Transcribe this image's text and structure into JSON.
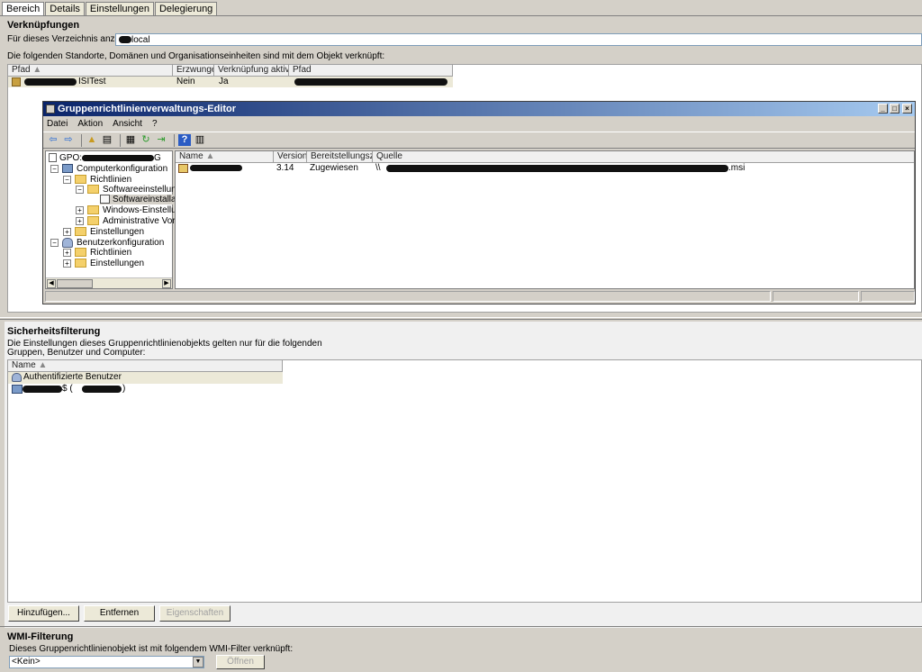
{
  "tabs": [
    "Bereich",
    "Details",
    "Einstellungen",
    "Delegierung"
  ],
  "links": {
    "title": "Verknüpfungen",
    "dir_label": "Für dieses Verzeichnis anzeigen:",
    "dir_value": "local",
    "description": "Die folgenden Standorte, Domänen und Organisationseinheiten sind mit dem Objekt verknüpft:",
    "columns": [
      "Pfad",
      "Erzwungen",
      "Verknüpfung aktiviert",
      "Pfad"
    ],
    "row": {
      "path_suffix": "SITest",
      "enforced": "Nein",
      "enabled": "Ja"
    }
  },
  "editor": {
    "title": "Gruppenrichtlinienverwaltungs-Editor",
    "menu": [
      "Datei",
      "Aktion",
      "Ansicht",
      "?"
    ],
    "tree": {
      "root": "GPO:",
      "computer": "Computerkonfiguration",
      "policies": "Richtlinien",
      "software_settings": "Softwareeinstellungen",
      "software_install": "Softwareinstallatio",
      "windows_settings": "Windows-Einstellungen",
      "admin_templates": "Administrative Vorlagen",
      "settings": "Einstellungen",
      "user": "Benutzerkonfiguration",
      "user_policies": "Richtlinien",
      "user_settings": "Einstellungen"
    },
    "columns": [
      "Name",
      "Version",
      "Bereitstellungsz...",
      "Quelle"
    ],
    "row": {
      "version": "3.14",
      "deployment": "Zugewiesen",
      "source_prefix": "\\\\",
      "source_suffix": ".msi"
    }
  },
  "security": {
    "title": "Sicherheitsfilterung",
    "description_line1": "Die Einstellungen dieses Gruppenrichtlinienobjekts gelten nur für die folgenden",
    "description_line2": "Gruppen, Benutzer und Computer:",
    "column": "Name",
    "items": [
      "Authentifizierte Benutzer",
      "$ (",
      ")"
    ],
    "buttons": {
      "add": "Hinzufügen...",
      "remove": "Entfernen",
      "properties": "Eigenschaften"
    }
  },
  "wmi": {
    "title": "WMI-Filterung",
    "description": "Dieses Gruppenrichtlinienobjekt ist mit folgendem WMI-Filter verknüpft:",
    "selected": "<Kein>",
    "open": "Öffnen"
  }
}
